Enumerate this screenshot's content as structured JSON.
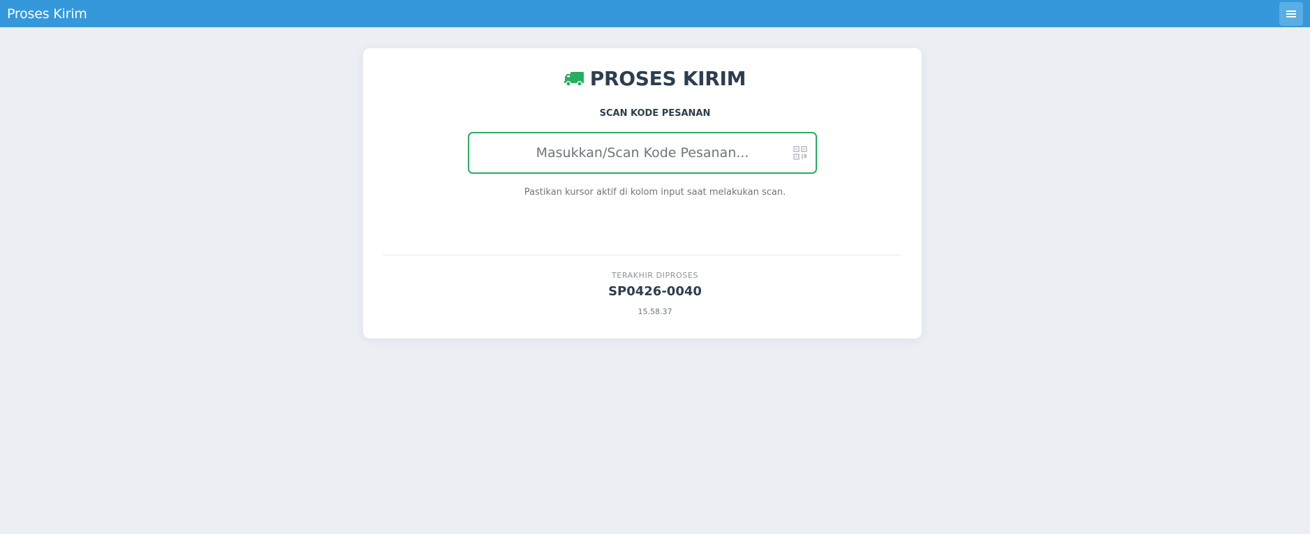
{
  "header": {
    "title": "Proses Kirim",
    "menu_icon": "hamburger-menu-icon",
    "background_color": "#3598db"
  },
  "card": {
    "icon": "truck-icon",
    "icon_color": "#27ae60",
    "title": "PROSES KIRIM",
    "scan_label": "SCAN KODE PESANAN",
    "input": {
      "value": "",
      "placeholder": "Masukkan/Scan Kode Pesanan...",
      "icon": "qr-code-icon",
      "border_color": "#27ae60"
    },
    "hint": "Pastikan kursor aktif di kolom input saat melakukan scan.",
    "last_processed": {
      "label": "TERAKHIR DIPROSES",
      "code": "SP0426-0040",
      "time": "15.58.37"
    }
  }
}
